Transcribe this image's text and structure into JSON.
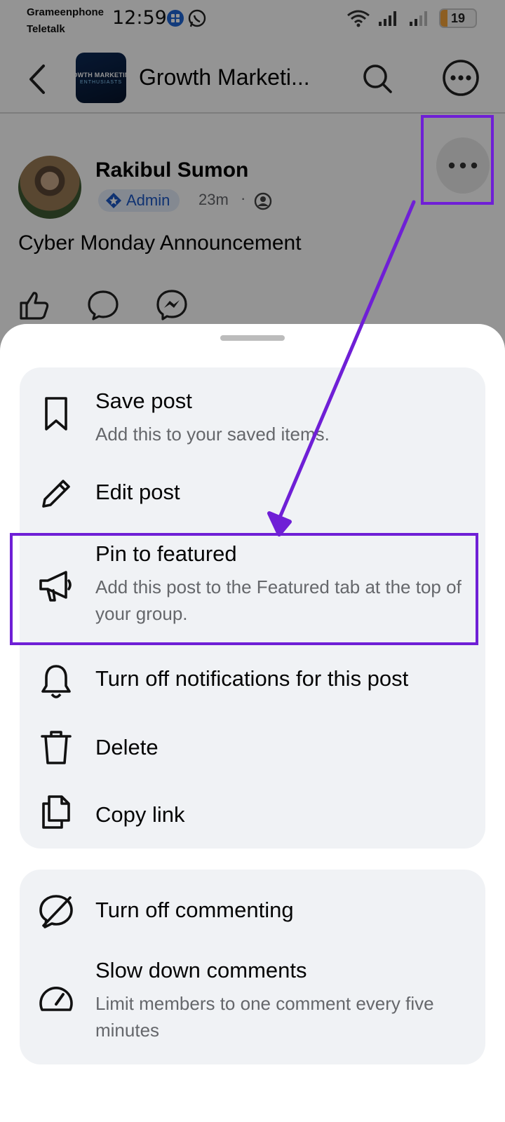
{
  "status_bar": {
    "carrier_1": "Grameenphone",
    "carrier_2": "Teletalk",
    "time": "12:59",
    "battery_level": 19,
    "battery_label": "19"
  },
  "header": {
    "group_title": "Growth Marketi...",
    "group_thumb_line1": "OWTH MARKETIN",
    "group_thumb_line2": "ENTHUSIASTS",
    "back_icon": "back-arrow-icon",
    "search_icon": "search-icon",
    "more_icon": "more-circle-icon"
  },
  "post": {
    "author": "Rakibul Sumon",
    "badge": "Admin",
    "time": "23m",
    "separator": "·",
    "text": "Cyber Monday Announcement",
    "actions": [
      "like-icon",
      "comment-icon",
      "messenger-icon"
    ]
  },
  "sheet": {
    "group_1": [
      {
        "title": "Save post",
        "subtitle": "Add this to your saved items.",
        "icon": "bookmark-icon"
      },
      {
        "title": "Edit post",
        "subtitle": "",
        "icon": "pencil-icon"
      },
      {
        "title": "Pin to featured",
        "subtitle": "Add this post to the Featured tab at the top of your group.",
        "icon": "megaphone-icon"
      },
      {
        "title": "Turn off notifications for this post",
        "subtitle": "",
        "icon": "bell-icon"
      },
      {
        "title": "Delete",
        "subtitle": "",
        "icon": "trash-icon"
      },
      {
        "title": "Copy link",
        "subtitle": "",
        "icon": "copy-icon"
      }
    ],
    "group_2": [
      {
        "title": "Turn off commenting",
        "subtitle": "",
        "icon": "comment-off-icon"
      },
      {
        "title": "Slow down comments",
        "subtitle": "Limit members to one comment every five minutes",
        "icon": "gauge-icon"
      }
    ]
  },
  "colors": {
    "accent": "#6f1fd6",
    "admin_badge_text": "#1b56c4",
    "battery": "#f3a23a"
  }
}
